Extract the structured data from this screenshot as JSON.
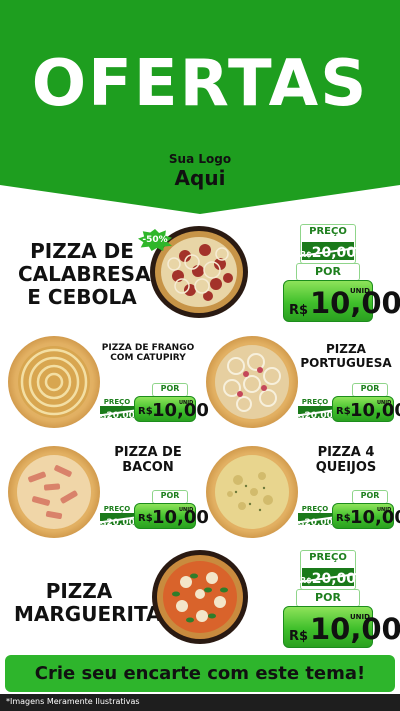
{
  "header": {
    "title": "OFERTAS",
    "logo_line1": "Sua Logo",
    "logo_line2": "Aqui"
  },
  "featured": [
    {
      "name": [
        "PIZZA DE",
        "CALABRESA",
        "E CEBOLA"
      ],
      "badge": "-50%",
      "price_label": "PREÇO",
      "old_currency": "R$",
      "old_price": "20,00",
      "por_label": "POR",
      "currency": "R$",
      "price": "10,00",
      "unit": "UNID"
    },
    {
      "name": [
        "PIZZA",
        "MARGUERITA"
      ],
      "price_label": "PREÇO",
      "old_currency": "R$",
      "old_price": "20,00",
      "por_label": "POR",
      "currency": "R$",
      "price": "10,00",
      "unit": "UNID"
    }
  ],
  "grid": [
    {
      "name": [
        "PIZZA DE FRANGO",
        "COM CATUPIRY"
      ],
      "price_label": "PREÇO",
      "old_currency": "R$",
      "old_price": "20,00",
      "por_label": "POR",
      "currency": "R$",
      "price": "10,00",
      "unit": "UNID"
    },
    {
      "name": [
        "PIZZA",
        "PORTUGUESA"
      ],
      "price_label": "PREÇO",
      "old_currency": "R$",
      "old_price": "20,00",
      "por_label": "POR",
      "currency": "R$",
      "price": "10,00",
      "unit": "UNID"
    },
    {
      "name": [
        "PIZZA DE",
        "BACON"
      ],
      "price_label": "PREÇO",
      "old_currency": "R$",
      "old_price": "20,00",
      "por_label": "POR",
      "currency": "R$",
      "price": "10,00",
      "unit": "UNID"
    },
    {
      "name": [
        "PIZZA 4",
        "QUEIJOS"
      ],
      "price_label": "PREÇO",
      "old_currency": "R$",
      "old_price": "20,00",
      "por_label": "POR",
      "currency": "R$",
      "price": "10,00",
      "unit": "UNID"
    }
  ],
  "footer": {
    "cta": "Crie seu encarte com este tema!",
    "disclaimer": "*Imagens Meramente Ilustrativas"
  },
  "colors": {
    "brand_green": "#1e9e1f",
    "price_green": "#3fbf2b",
    "dark_green": "#1a7a1a"
  }
}
